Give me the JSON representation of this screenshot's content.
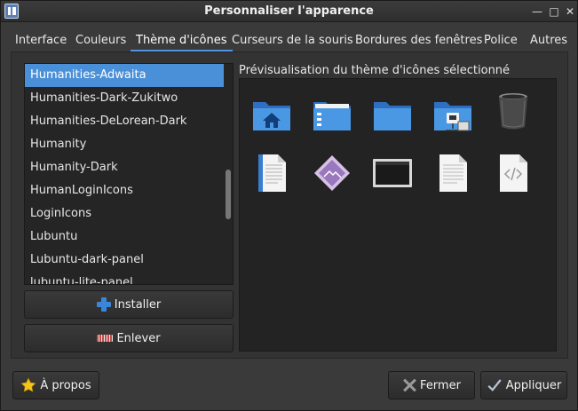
{
  "window": {
    "title": "Personnaliser l'apparence"
  },
  "tabs": [
    {
      "label": "Interface"
    },
    {
      "label": "Couleurs"
    },
    {
      "label": "Thème d'icônes"
    },
    {
      "label": "Curseurs de la souris"
    },
    {
      "label": "Bordures des fenêtres"
    },
    {
      "label": "Police"
    },
    {
      "label": "Autres"
    }
  ],
  "icon_themes": [
    {
      "label": "Humanities-Adwaita"
    },
    {
      "label": "Humanities-Dark-Zukitwo"
    },
    {
      "label": "Humanities-DeLorean-Dark"
    },
    {
      "label": "Humanity"
    },
    {
      "label": "Humanity-Dark"
    },
    {
      "label": "HumanLoginIcons"
    },
    {
      "label": "LoginIcons"
    },
    {
      "label": "Lubuntu"
    },
    {
      "label": "Lubuntu-dark-panel"
    },
    {
      "label": "lubuntu-lite-panel"
    }
  ],
  "buttons": {
    "install": "Installer",
    "remove": "Enlever",
    "about": "À propos",
    "close": "Fermer",
    "apply": "Appliquer"
  },
  "preview": {
    "label": "Prévisualisation du thème d'icônes sélectionné",
    "icons": [
      "home-folder-icon",
      "desktop-folder-icon",
      "folder-icon",
      "network-folder-icon",
      "trash-icon",
      "text-document-icon",
      "image-document-icon",
      "computer-monitor-icon",
      "document-icon",
      "code-document-icon"
    ]
  },
  "colors": {
    "accent": "#4a90d9",
    "window_bg": "#3a3a3a",
    "list_bg": "#252525"
  }
}
